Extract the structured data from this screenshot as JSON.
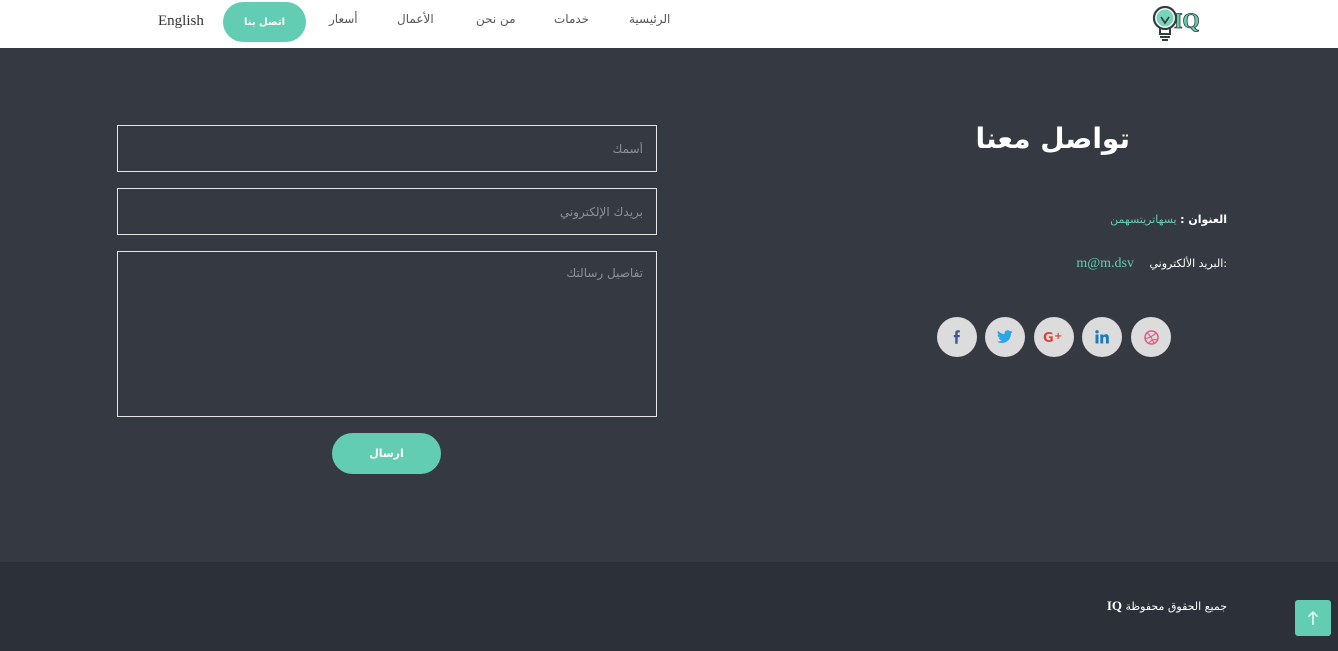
{
  "nav": {
    "logo_text": "IQ",
    "items": [
      {
        "label": "الرئيسية"
      },
      {
        "label": "خدمات"
      },
      {
        "label": "من نحن"
      },
      {
        "label": "الأعمال"
      },
      {
        "label": "أسعار"
      }
    ],
    "contact_label": "اتصل بنا",
    "language_label": "English"
  },
  "contact": {
    "title": "تواصل معنا",
    "address_label": "العنوان :",
    "address_value": "يسهاتريتسهمن",
    "email_label": ":البريد الألكتروني",
    "email_value": "m@m.dsv"
  },
  "social": [
    {
      "icon": "dribbble-icon",
      "color": "#e4577f"
    },
    {
      "icon": "linkedin-icon",
      "color": "#1f7bb8"
    },
    {
      "icon": "google-plus-icon",
      "color": "#d2473b"
    },
    {
      "icon": "twitter-icon",
      "color": "#29a6e8"
    },
    {
      "icon": "facebook-icon",
      "color": "#3b5a99"
    }
  ],
  "form": {
    "name_placeholder": "أسمك",
    "email_placeholder": "بريدك الإلكتروني",
    "message_placeholder": "تفاصيل رسالتك",
    "send_label": "ارسال"
  },
  "footer": {
    "copyright_text": "جميع الحقوق محفوظة",
    "brand": "IQ"
  },
  "colors": {
    "accent": "#62cdb3",
    "section_bg": "#353a42",
    "footer_bg": "#2c3038"
  }
}
